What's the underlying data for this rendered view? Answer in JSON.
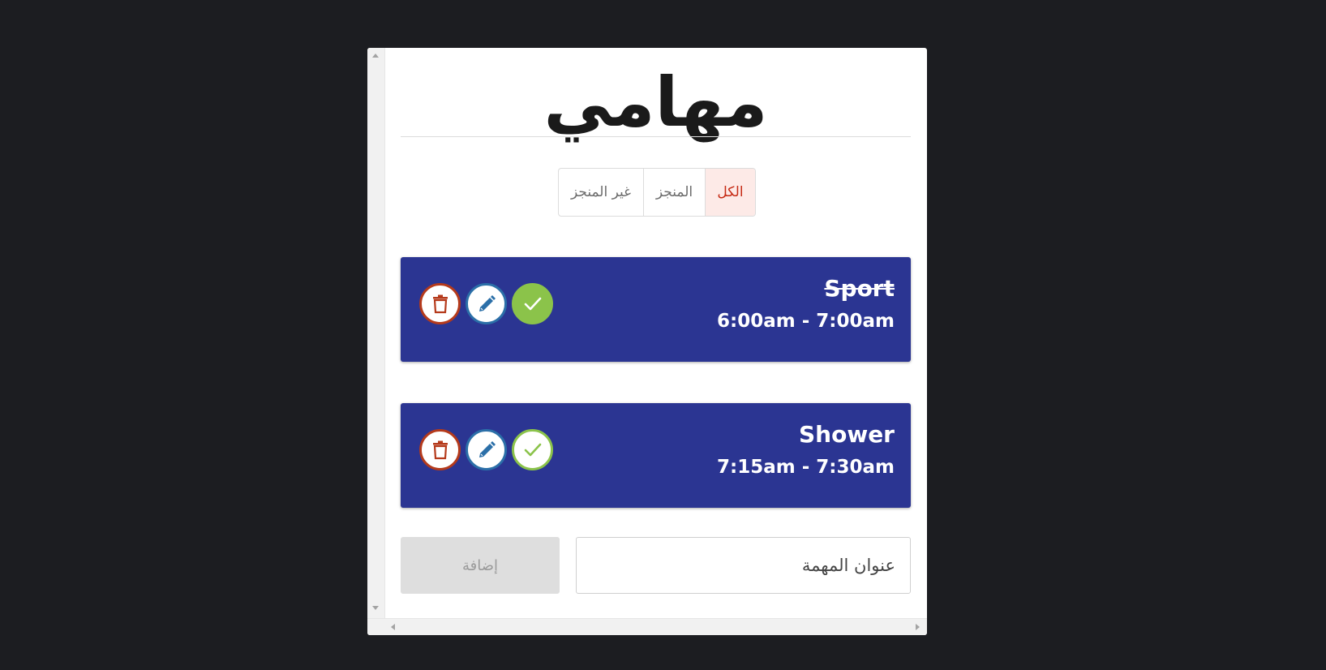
{
  "app": {
    "title": "مهامي"
  },
  "filters": [
    {
      "label": "الكل",
      "active": true
    },
    {
      "label": "المنجز",
      "active": false
    },
    {
      "label": "غير المنجز",
      "active": false
    }
  ],
  "tasks": [
    {
      "title": "Sport",
      "time": "6:00am - 7:00am",
      "done": true
    },
    {
      "title": "Shower",
      "time": "7:15am - 7:30am",
      "done": false
    }
  ],
  "icons": {
    "delete": "trash-icon",
    "edit": "pencil-icon",
    "complete": "check-icon"
  },
  "colors": {
    "task_bg": "#2b3592",
    "delete": "#b53a1b",
    "edit": "#2b6fa8",
    "complete": "#8bc34a",
    "active_filter_text": "#c62b15",
    "active_filter_bg": "#fdeae7"
  },
  "form": {
    "add_label": "إضافة",
    "input_placeholder": "عنوان المهمة",
    "input_value": ""
  }
}
